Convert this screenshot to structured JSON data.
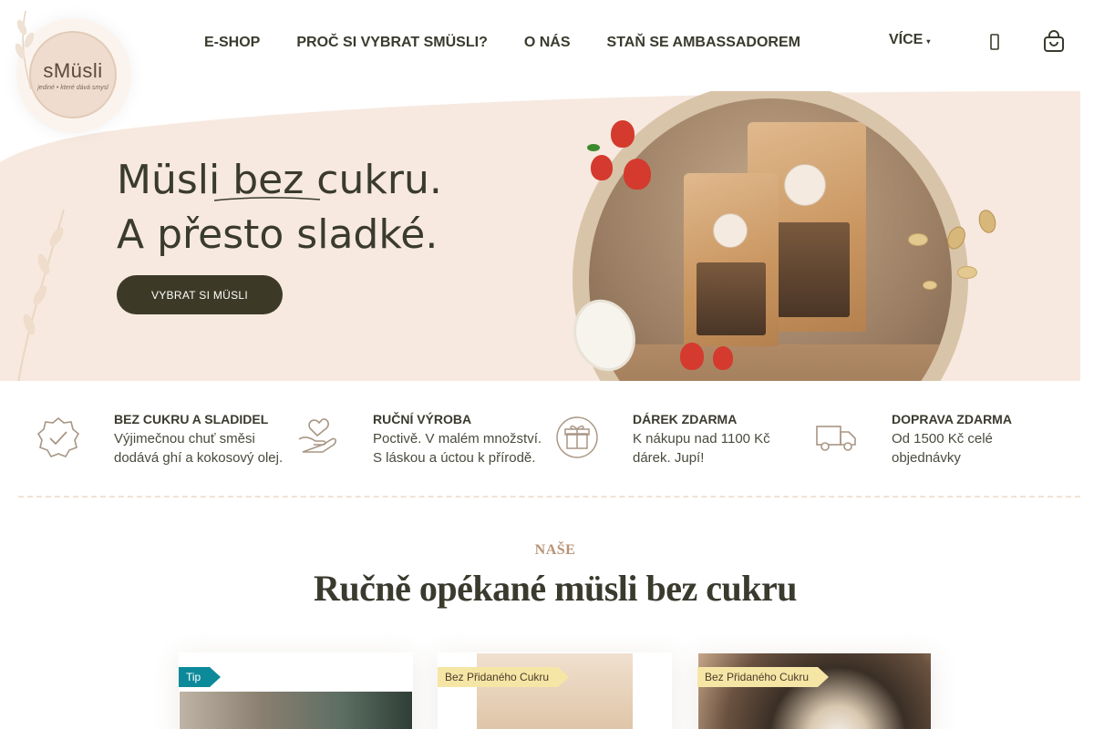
{
  "logo": {
    "name": "sMüsli",
    "tagline": "jediné • které dává smysl"
  },
  "nav": {
    "items": [
      {
        "label": "E-SHOP"
      },
      {
        "label": "PROČ SI VYBRAT SMÜSLI?"
      },
      {
        "label": "O NÁS"
      },
      {
        "label": "STAŇ SE AMBASSADOREM"
      }
    ],
    "more_label": "VÍCE",
    "user_icon": "user-icon",
    "cart_icon": "cart-icon"
  },
  "hero": {
    "title_line1": "Müsli bez cukru.",
    "title_line2": "A přesto sladké.",
    "cta_label": "VYBRAT SI MÜSLI",
    "colors": {
      "background": "#f7e9df",
      "button": "#3c3a26"
    }
  },
  "features": [
    {
      "icon": "check-badge-icon",
      "title": "BEZ CUKRU A SLADIDEL",
      "desc": "Výjimečnou chuť směsi dodává ghí a kokosový olej."
    },
    {
      "icon": "hand-heart-icon",
      "title": "RUČNÍ VÝROBA",
      "desc": "Poctivě. V malém množství. S láskou a úctou k přírodě."
    },
    {
      "icon": "gift-icon",
      "title": "DÁREK ZDARMA",
      "desc": "K nákupu nad 1100 Kč dárek. Jupí!"
    },
    {
      "icon": "truck-icon",
      "title": "DOPRAVA ZDARMA",
      "desc": "Od 1500 Kč celé objednávky"
    }
  ],
  "section": {
    "kicker": "NAŠE",
    "title": "Ručně opékané müsli bez cukru"
  },
  "cards": [
    {
      "ribbon": "Tip",
      "ribbon_color": "#0d8a9a"
    },
    {
      "ribbon": "Bez Přidaného Cukru",
      "ribbon_color": "#f6e6a6"
    },
    {
      "ribbon": "Bez Přidaného Cukru",
      "ribbon_color": "#f6e6a6"
    }
  ]
}
